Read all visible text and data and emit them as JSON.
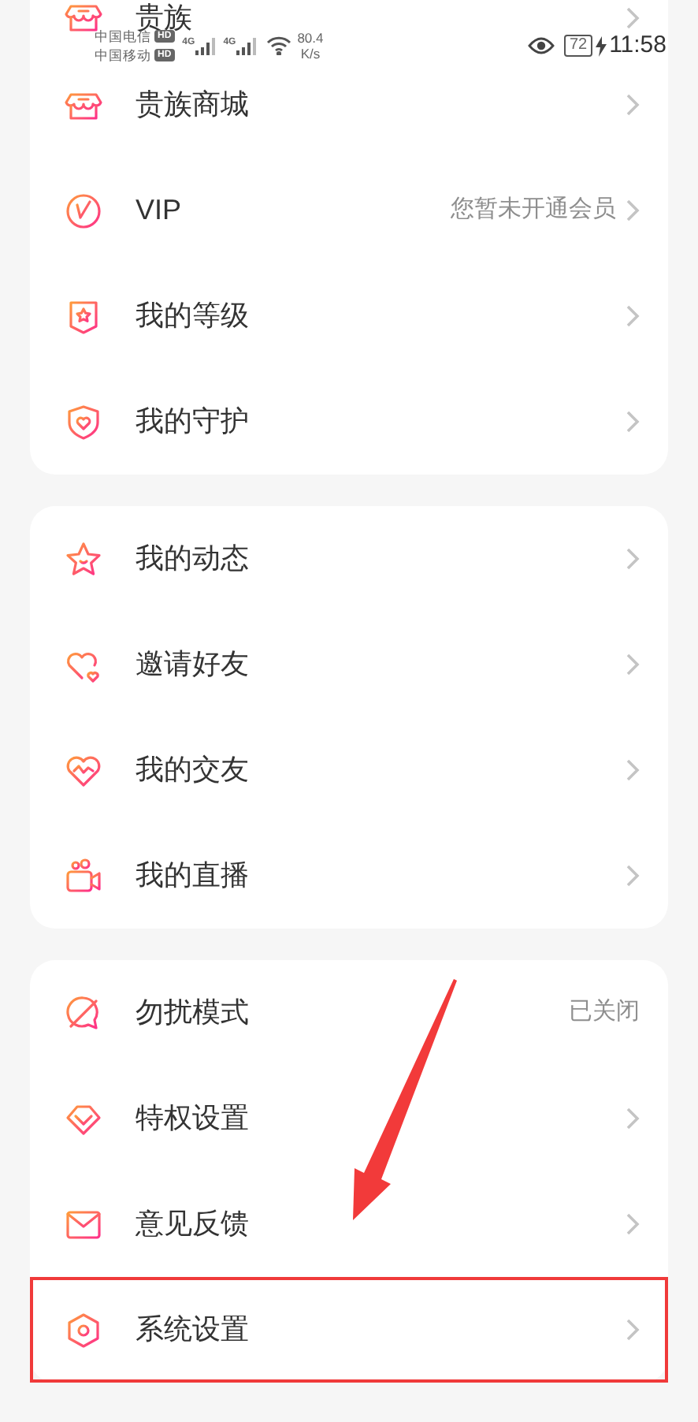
{
  "status_bar": {
    "carriers": [
      {
        "name": "中国电信",
        "badge": "HD"
      },
      {
        "name": "中国移动",
        "badge": "HD"
      }
    ],
    "signals": [
      {
        "type": "4G"
      },
      {
        "type": "4G"
      }
    ],
    "speed": {
      "value": "80.4",
      "unit": "K/s"
    },
    "battery": "72",
    "charging": true,
    "time": "11:58"
  },
  "sections": [
    {
      "items": [
        {
          "label": "贵族",
          "chevron": true,
          "highlighted": false
        },
        {
          "label": "贵族商城",
          "chevron": true,
          "highlighted": false
        },
        {
          "label": "VIP",
          "value": "您暂未开通会员",
          "chevron": true,
          "highlighted": false
        },
        {
          "label": "我的等级",
          "chevron": true,
          "highlighted": false
        },
        {
          "label": "我的守护",
          "chevron": true,
          "highlighted": false
        }
      ]
    },
    {
      "items": [
        {
          "label": "我的动态",
          "chevron": true,
          "highlighted": false
        },
        {
          "label": "邀请好友",
          "chevron": true,
          "highlighted": false
        },
        {
          "label": "我的交友",
          "chevron": true,
          "highlighted": false
        },
        {
          "label": "我的直播",
          "chevron": true,
          "highlighted": false
        }
      ]
    },
    {
      "items": [
        {
          "label": "勿扰模式",
          "value": "已关闭",
          "chevron": false,
          "highlighted": false
        },
        {
          "label": "特权设置",
          "chevron": true,
          "highlighted": false
        },
        {
          "label": "意见反馈",
          "chevron": true,
          "highlighted": false
        },
        {
          "label": "系统设置",
          "chevron": true,
          "highlighted": true
        }
      ]
    }
  ]
}
